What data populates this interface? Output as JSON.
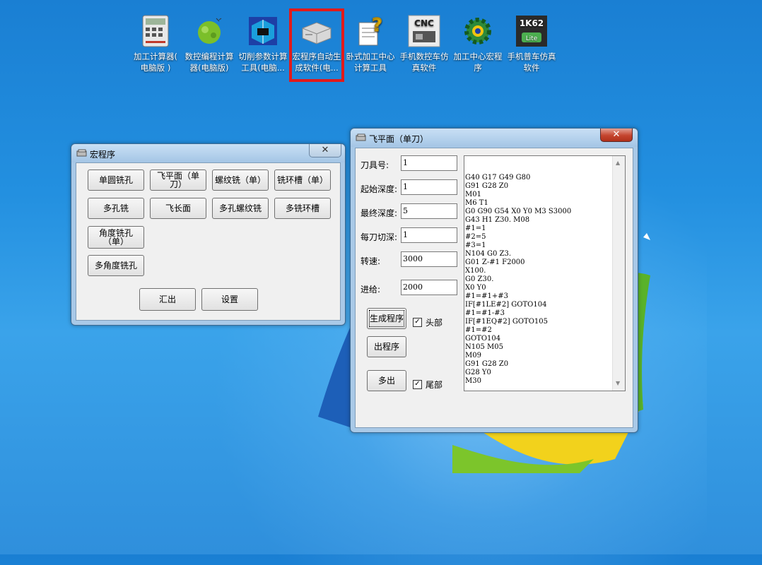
{
  "desktop": {
    "icons": [
      {
        "label": "加工计算器( 电脑版 )",
        "icon": "calculator-icon"
      },
      {
        "label": "数控编程计算器(电脑版)",
        "icon": "green-blob-icon"
      },
      {
        "label": "切削参数计算工具(电脑...",
        "icon": "cube-tool-icon"
      },
      {
        "label": "宏程序自动生成软件(电...",
        "icon": "server-box-icon",
        "selected": true
      },
      {
        "label": "卧式加工中心计算工具",
        "icon": "document-question-icon"
      },
      {
        "label": "手机数控车仿真软件",
        "icon": "cnc-machine-icon",
        "badge": "CNC"
      },
      {
        "label": "加工中心宏程序",
        "icon": "gear-icon"
      },
      {
        "label": "手机普车仿真软件",
        "icon": "lathe-lite-icon",
        "badge": "1K62",
        "sub": "Lite"
      }
    ]
  },
  "macro_window": {
    "title": "宏程序",
    "close": "✕",
    "buttons": [
      "单圆铣孔",
      "飞平面（单刀）",
      "螺纹铣（单）",
      "铣环槽（单）",
      "多孔铣",
      "飞长面",
      "多孔螺纹铣",
      "多铣环槽",
      "角度铣孔（单）",
      "多角度铣孔"
    ],
    "export_label": "汇出",
    "settings_label": "设置"
  },
  "face_window": {
    "title": "飞平面（单刀）",
    "close": "✕",
    "fields": [
      {
        "label": "刀具号:",
        "value": "1"
      },
      {
        "label": "起始深度:",
        "value": "1"
      },
      {
        "label": "最终深度:",
        "value": "5"
      },
      {
        "label": "每刀切深:",
        "value": "1"
      },
      {
        "label": "转速:",
        "value": "3000"
      },
      {
        "label": "进给:",
        "value": "2000"
      }
    ],
    "generate_label": "生成程序",
    "output_label": "出程序",
    "multi_output_label": "多出",
    "header_check": {
      "label": "头部",
      "checked": true
    },
    "footer_check": {
      "label": "尾部",
      "checked": true
    },
    "program_lines": [
      "G40 G17 G49 G80",
      "G91 G28 Z0",
      "M01",
      "M6 T1",
      "G0 G90 G54 X0 Y0 M3 S3000",
      "G43 H1 Z30. M08",
      "#1=1",
      "#2=5",
      "#3=1",
      "N104 G0 Z3.",
      "G01 Z-#1 F2000",
      "X100.",
      "G0 Z30.",
      "X0 Y0",
      "#1=#1+#3",
      "IF[#1LE#2] GOTO104",
      "#1=#1-#3",
      "IF[#1EQ#2] GOTO105",
      "#1=#2",
      "GOTO104",
      "N105 M05",
      "M09",
      "G91 G28 Z0",
      "G28 Y0",
      "M30"
    ]
  }
}
